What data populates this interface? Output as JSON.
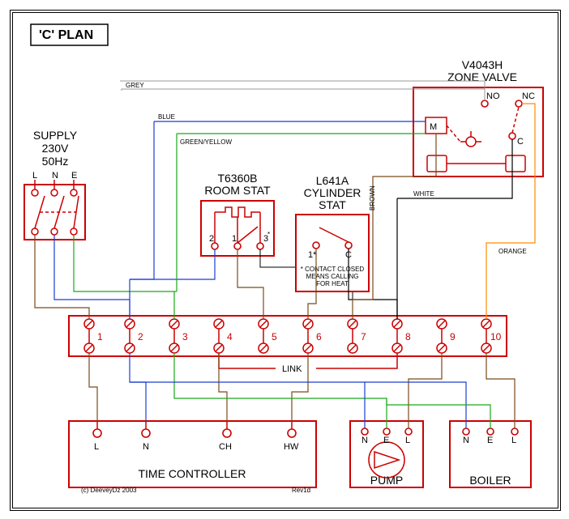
{
  "title": "'C' PLAN",
  "supply": {
    "label": "SUPPLY",
    "voltage": "230V",
    "freq": "50Hz",
    "terms": [
      "L",
      "N",
      "E"
    ]
  },
  "zonevalve": {
    "model": "V4043H",
    "label": "ZONE VALVE",
    "motor": "M",
    "no": "NO",
    "nc": "NC",
    "c": "C"
  },
  "roomstat": {
    "model": "T6360B",
    "label": "ROOM STAT",
    "terms": [
      "2",
      "1",
      "3"
    ],
    "star": "*"
  },
  "cylstat": {
    "model": "L641A",
    "label": "CYLINDER",
    "label2": "STAT",
    "terms": [
      "1*",
      "C"
    ],
    "note1": "* CONTACT CLOSED",
    "note2": "MEANS CALLING",
    "note3": "FOR HEAT"
  },
  "wiring_centre": {
    "terms": [
      "1",
      "2",
      "3",
      "4",
      "5",
      "6",
      "7",
      "8",
      "9",
      "10"
    ],
    "link": "LINK"
  },
  "timecontroller": {
    "label": "TIME CONTROLLER",
    "terms": [
      "L",
      "N",
      "CH",
      "HW"
    ]
  },
  "pump": {
    "label": "PUMP",
    "terms": [
      "N",
      "E",
      "L"
    ]
  },
  "boiler": {
    "label": "BOILER",
    "terms": [
      "N",
      "E",
      "L"
    ]
  },
  "wire_labels": {
    "grey": "GREY",
    "blue": "BLUE",
    "gy": "GREEN/YELLOW",
    "brown": "BROWN",
    "white": "WHITE",
    "orange": "ORANGE"
  },
  "footer": {
    "copyright": "(c) DeeveyDz 2003",
    "rev": "Rev1d"
  }
}
